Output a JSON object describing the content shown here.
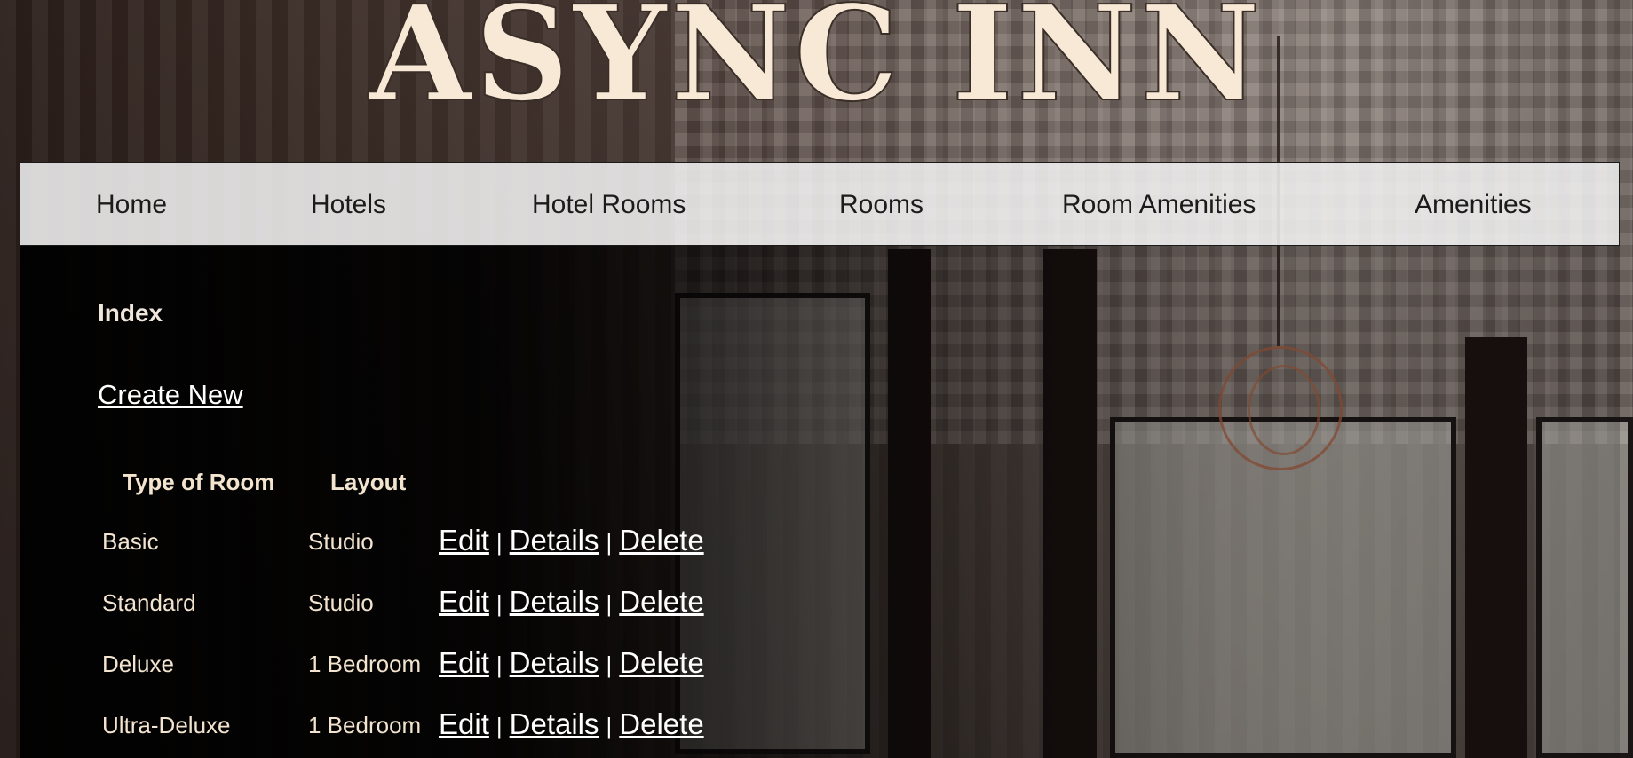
{
  "site": {
    "title": "ASYNC INN"
  },
  "nav": {
    "items": [
      {
        "label": "Home"
      },
      {
        "label": "Hotels"
      },
      {
        "label": "Hotel Rooms"
      },
      {
        "label": "Rooms"
      },
      {
        "label": "Room Amenities"
      },
      {
        "label": "Amenities"
      }
    ]
  },
  "page": {
    "heading": "Index",
    "create_link": "Create New"
  },
  "table": {
    "headers": [
      "Type of Room",
      "Layout"
    ],
    "rows": [
      {
        "type": "Basic",
        "layout": "Studio"
      },
      {
        "type": "Standard",
        "layout": "Studio"
      },
      {
        "type": "Deluxe",
        "layout": "1 Bedroom"
      },
      {
        "type": "Ultra-Deluxe",
        "layout": "1 Bedroom"
      }
    ],
    "actions": {
      "edit": "Edit",
      "details": "Details",
      "delete": "Delete",
      "separator": "|"
    }
  }
}
